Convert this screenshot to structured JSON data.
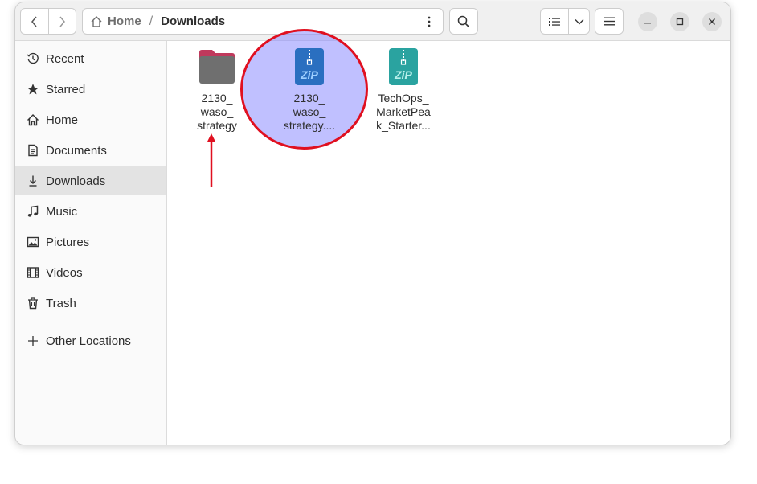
{
  "pathbar": {
    "home_label": "Home",
    "separator": "/",
    "current_label": "Downloads"
  },
  "sidebar": {
    "items": [
      {
        "label": "Recent",
        "icon": "clock-icon"
      },
      {
        "label": "Starred",
        "icon": "star-icon"
      },
      {
        "label": "Home",
        "icon": "home-icon"
      },
      {
        "label": "Documents",
        "icon": "document-icon"
      },
      {
        "label": "Downloads",
        "icon": "download-icon",
        "active": true
      },
      {
        "label": "Music",
        "icon": "music-note-icon"
      },
      {
        "label": "Pictures",
        "icon": "picture-icon"
      },
      {
        "label": "Videos",
        "icon": "film-icon"
      },
      {
        "label": "Trash",
        "icon": "trash-icon"
      }
    ],
    "other_locations": {
      "label": "Other Locations",
      "icon": "plus-icon"
    }
  },
  "files": [
    {
      "name": "2130_\nwaso_\nstrategy",
      "type": "folder",
      "icon": "folder-icon"
    },
    {
      "name": "2130_\nwaso_\nstrategy....",
      "type": "zip",
      "icon": "zip-archive-icon",
      "icon_label": "ZiP",
      "selected": true
    },
    {
      "name": "TechOps_\nMarketPea\nk_Starter...",
      "type": "zip",
      "icon": "zip-archive-icon",
      "icon_label": "ZiP"
    }
  ],
  "colors": {
    "selection_fill": "#8c8cff",
    "annotation_red": "#e01020",
    "folder_tab": "#c0395c",
    "folder_body": "#6f6f6f",
    "zip_blue": "#2a6fc0",
    "zip_teal": "#2aa3a0"
  }
}
